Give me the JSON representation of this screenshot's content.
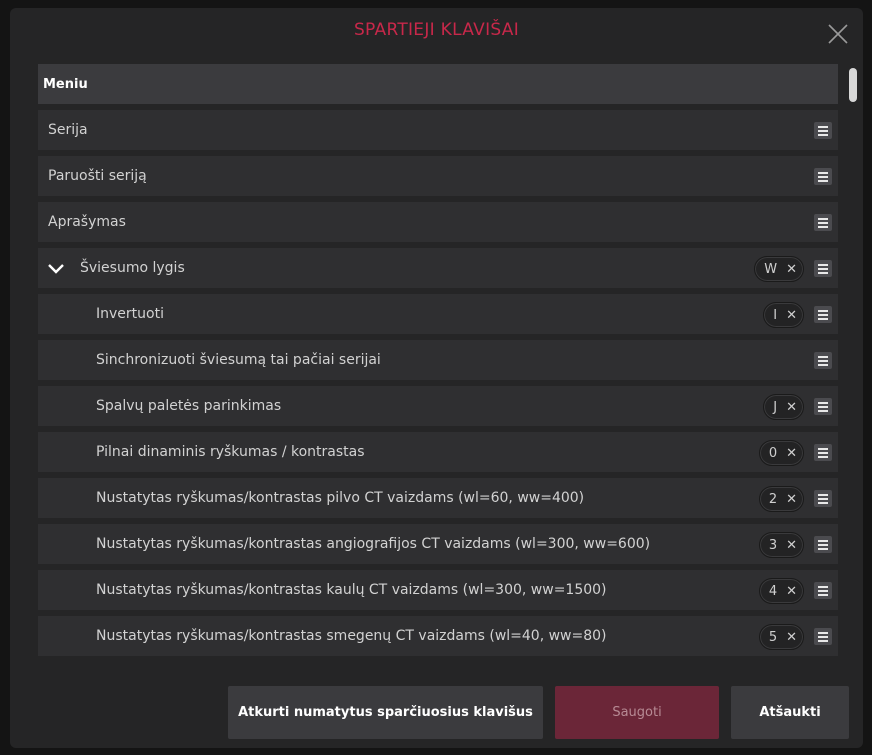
{
  "dialog": {
    "title": "SPARTIEJI KLAVIŠAI"
  },
  "shortcuts": {
    "header": "Meniu",
    "rows": [
      {
        "label": "Serija",
        "key": ""
      },
      {
        "label": "Paruošti seriją",
        "key": ""
      },
      {
        "label": "Aprašymas",
        "key": ""
      },
      {
        "label": "Šviesumo lygis",
        "key": "W",
        "expanded": true
      },
      {
        "label": "Invertuoti",
        "key": "I"
      },
      {
        "label": "Sinchronizuoti šviesumą tai pačiai serijai",
        "key": ""
      },
      {
        "label": "Spalvų paletės parinkimas",
        "key": "J"
      },
      {
        "label": "Pilnai dinaminis ryškumas / kontrastas",
        "key": "0"
      },
      {
        "label": "Nustatytas ryškumas/kontrastas pilvo CT vaizdams (wl=60, ww=400)",
        "key": "2"
      },
      {
        "label": "Nustatytas ryškumas/kontrastas angiografijos CT vaizdams (wl=300, ww=600)",
        "key": "3"
      },
      {
        "label": "Nustatytas ryškumas/kontrastas kaulų CT vaizdams (wl=300, ww=1500)",
        "key": "4"
      },
      {
        "label": "Nustatytas ryškumas/kontrastas smegenų CT vaizdams (wl=40, ww=80)",
        "key": "5"
      }
    ],
    "remove_glyph": "✕",
    "menu_icon": "hamburger-icon",
    "expand_icon": "chevron-down-icon"
  },
  "footer": {
    "reset_label": "Atkurti numatytus sparčiuosius klavišus",
    "save_label": "Saugoti",
    "cancel_label": "Atšaukti"
  },
  "colors": {
    "accent": "#c8284a",
    "save_button": "#6b2638",
    "panel": "#252526",
    "row": "#2f2f31"
  }
}
